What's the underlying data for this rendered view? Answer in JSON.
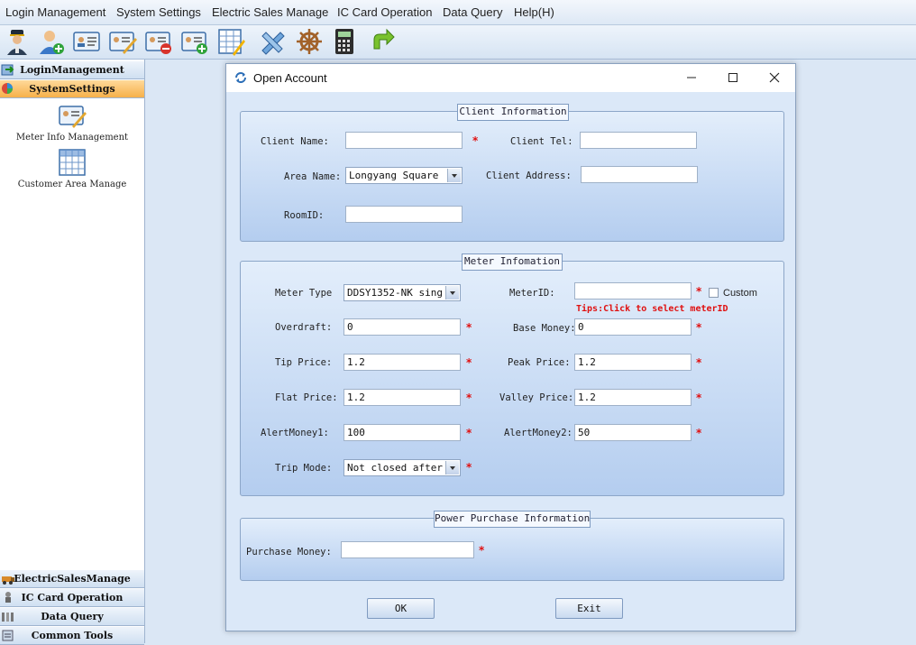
{
  "menu": [
    "Login Management",
    "System Settings",
    "Electric Sales Manage",
    "IC Card Operation",
    "Data Query",
    "Help(H)"
  ],
  "toolbar_icons": [
    "operator-icon",
    "add-user-icon",
    "client-card-icon",
    "edit-card-icon",
    "remove-card-icon",
    "add-card-icon",
    "table-edit-icon",
    "tools-icon",
    "helm-icon",
    "calculator-icon",
    "refresh-icon"
  ],
  "sidebar": {
    "top_sections": [
      "LoginManagement",
      "SystemSettings"
    ],
    "items": [
      "Meter Info Management",
      "Customer Area Manage"
    ],
    "bottom_sections": [
      "ElectricSalesManage",
      "IC Card Operation",
      "Data Query",
      "Common Tools"
    ]
  },
  "dialog": {
    "title": "Open Account",
    "client": {
      "legend": "Client Information",
      "client_name_label": "Client Name:",
      "client_name": "",
      "client_tel_label": "Client Tel:",
      "client_tel": "",
      "area_name_label": "Area Name:",
      "area_name": "Longyang Square",
      "client_address_label": "Client Address:",
      "client_address": "",
      "room_id_label": "RoomID:",
      "room_id": ""
    },
    "meter": {
      "legend": "Meter Infomation",
      "meter_type_label": "Meter Type",
      "meter_type": "DDSY1352-NK sing",
      "meter_id_label": "MeterID:",
      "meter_id": "",
      "custom_label": "Custom",
      "tips": "Tips:Click to select meterID",
      "overdraft_label": "Overdraft:",
      "overdraft": "0",
      "base_money_label": "Base Money:",
      "base_money": "0",
      "tip_price_label": "Tip Price:",
      "tip_price": "1.2",
      "peak_price_label": "Peak Price:",
      "peak_price": "1.2",
      "flat_price_label": "Flat Price:",
      "flat_price": "1.2",
      "valley_price_label": "Valley Price:",
      "valley_price": "1.2",
      "alert1_label": "AlertMoney1:",
      "alert1": "100",
      "alert2_label": "AlertMoney2:",
      "alert2": "50",
      "trip_mode_label": "Trip Mode:",
      "trip_mode": "Not closed after"
    },
    "purchase": {
      "legend": "Power Purchase Information",
      "purchase_money_label": "Purchase Money:",
      "purchase_money": ""
    },
    "ok_label": "OK",
    "exit_label": "Exit",
    "required_mark": "*"
  }
}
